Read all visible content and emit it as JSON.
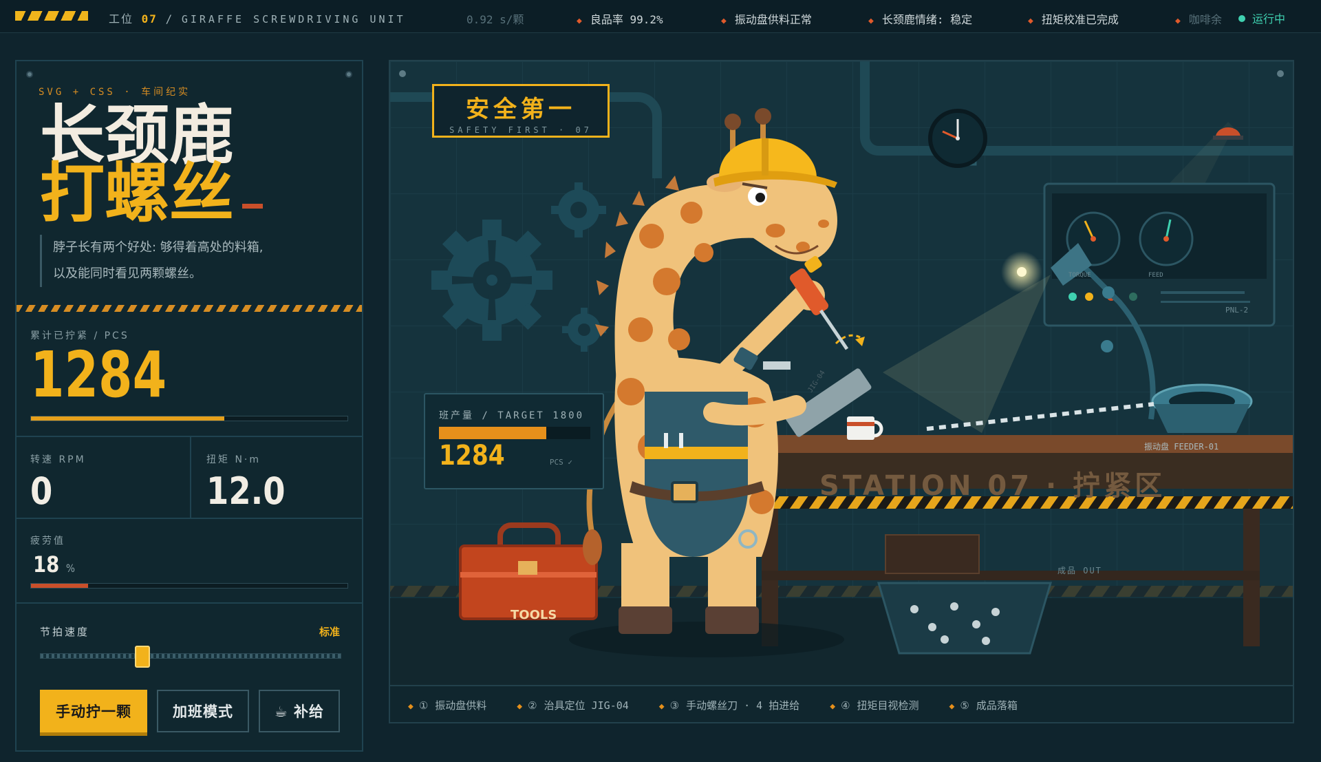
{
  "topbar": {
    "station_prefix": "工位",
    "station_no": "07",
    "station_sep": "/",
    "unit_name": "GIRAFFE SCREWDRIVING UNIT",
    "ticker": [
      {
        "text": "0.92 s/颗"
      },
      {
        "text": "良品率 99.2%"
      },
      {
        "text": "振动盘供料正常"
      },
      {
        "text": "长颈鹿情绪: 稳定"
      },
      {
        "text": "扭矩校准已完成"
      },
      {
        "text": "咖啡余"
      }
    ],
    "status": "运行中"
  },
  "panel": {
    "kicker": "SVG + CSS · 车间纪实",
    "title_line1": "长颈鹿",
    "title_line2": "打螺丝",
    "desc_line1": "脖子长有两个好处: 够得着高处的料箱,",
    "desc_line2": "以及能同时看见两颗螺丝。",
    "count_label": "累计已拧紧 / PCS",
    "count_value": "1284",
    "count_progress": 0.61,
    "rpm_label": "转速 RPM",
    "rpm_value": "0",
    "torque_label": "扭矩 N·m",
    "torque_value": "12.0",
    "fatigue_label": "疲劳值",
    "fatigue_value": "18",
    "fatigue_unit": "%",
    "fatigue_progress": 0.18,
    "tempo_label": "节拍速度",
    "tempo_value": "标准",
    "tempo_position": 0.34,
    "btn_manual": "手动拧一颗",
    "btn_overtime": "加班模式",
    "btn_refill": "☕ 补给"
  },
  "scene": {
    "sign_cn": "安全第一",
    "sign_en": "SAFETY FIRST · 07",
    "target_label": "班产量 / TARGET 1800",
    "target_value": "1284",
    "target_unit": "PCS ✓",
    "target_progress": 0.71,
    "station_label": "STATION 07 · 拧紧区",
    "panel_id": "PNL-2",
    "gauge_torque": "TORQUE",
    "gauge_feed": "FEED",
    "feeder_label": "振动盘 FEEDER-01",
    "out_label": "成品 OUT",
    "toolbox_label": "TOOLS",
    "jig_label": "JIG-04"
  },
  "steps": [
    {
      "no": "①",
      "text": "振动盘供料"
    },
    {
      "no": "②",
      "text": "治具定位 JIG-04"
    },
    {
      "no": "③",
      "text": "手动螺丝刀 · 4 拍进给"
    },
    {
      "no": "④",
      "text": "扭矩目视检测"
    },
    {
      "no": "⑤",
      "text": "成品落箱"
    }
  ],
  "colors": {
    "accent": "#f2b21b",
    "danger": "#e05a2b",
    "ok": "#3fd1b0",
    "bg": "#0f242d"
  }
}
